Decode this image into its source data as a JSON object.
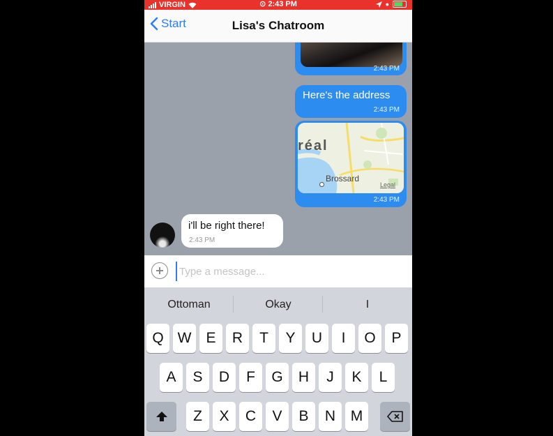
{
  "status_bar": {
    "carrier": "VIRGIN",
    "time": "2:43 PM",
    "icons": [
      "signal-icon",
      "wifi-icon",
      "alarm-icon",
      "location-icon",
      "battery-icon"
    ]
  },
  "nav": {
    "back_label": "Start",
    "title": "Lisa's Chatroom"
  },
  "messages": {
    "image": {
      "time": "2:43 PM"
    },
    "address": {
      "text": "Here's the address",
      "time": "2:43 PM"
    },
    "map": {
      "place_label": "réal",
      "city": "Brossard",
      "legal": "Legal",
      "time": "2:43 PM"
    },
    "incoming": {
      "text": "i'll be right there!",
      "time": "2:43 PM"
    }
  },
  "composer": {
    "placeholder": "Type a message..."
  },
  "keyboard": {
    "suggestions": [
      "Ottoman",
      "Okay",
      "I"
    ],
    "row1": [
      "Q",
      "W",
      "E",
      "R",
      "T",
      "Y",
      "U",
      "I",
      "O",
      "P"
    ],
    "row2": [
      "A",
      "S",
      "D",
      "F",
      "G",
      "H",
      "J",
      "K",
      "L"
    ],
    "row3": [
      "Z",
      "X",
      "C",
      "V",
      "B",
      "N",
      "M"
    ]
  },
  "colors": {
    "status_bar": "#e8322b",
    "accent": "#2f7cf6",
    "outgoing_bubble": "#2d8cf0",
    "chat_background": "#9aa1ab"
  }
}
